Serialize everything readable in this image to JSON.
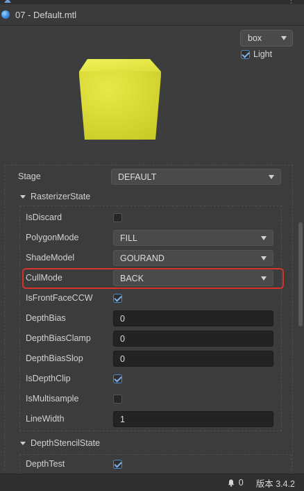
{
  "window": {
    "title": "07 - Default.mtl"
  },
  "preview": {
    "shape_dropdown": "box",
    "light_label": "Light",
    "light_checked": true,
    "cube_color": "#dfe03a"
  },
  "inspector": {
    "stage": {
      "label": "Stage",
      "value": "DEFAULT"
    },
    "rasterizer": {
      "section_title": "RasterizerState",
      "is_discard": {
        "label": "IsDiscard",
        "checked": false
      },
      "polygon_mode": {
        "label": "PolygonMode",
        "value": "FILL"
      },
      "shade_model": {
        "label": "ShadeModel",
        "value": "GOURAND"
      },
      "cull_mode": {
        "label": "CullMode",
        "value": "BACK"
      },
      "is_front_face_ccw": {
        "label": "IsFrontFaceCCW",
        "checked": true
      },
      "depth_bias": {
        "label": "DepthBias",
        "value": "0"
      },
      "depth_bias_clamp": {
        "label": "DepthBiasClamp",
        "value": "0"
      },
      "depth_bias_slop": {
        "label": "DepthBiasSlop",
        "value": "0"
      },
      "is_depth_clip": {
        "label": "IsDepthClip",
        "checked": true
      },
      "is_multisample": {
        "label": "IsMultisample",
        "checked": false
      },
      "line_width": {
        "label": "LineWidth",
        "value": "1"
      }
    },
    "depth_stencil": {
      "section_title": "DepthStencilState",
      "depth_test": {
        "label": "DepthTest",
        "checked": true
      }
    }
  },
  "status": {
    "notification_count": "0",
    "version": "版本 3.4.2"
  },
  "colors": {
    "highlight": "#d8322d",
    "accent": "#4f86c6"
  }
}
